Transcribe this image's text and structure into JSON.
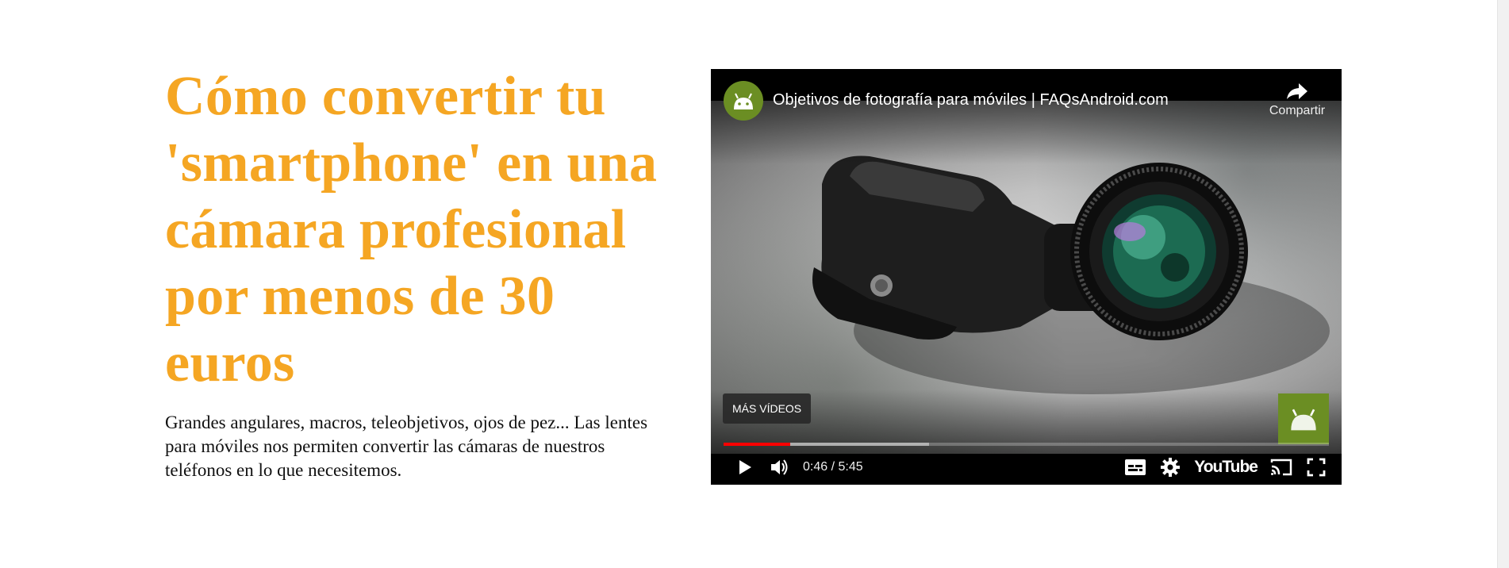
{
  "article": {
    "headline": "Cómo convertir tu 'smartphone' en una cámara profesional por menos de 30 euros",
    "summary": "Grandes angulares, macros, teleobjetivos, ojos de pez... Las lentes para móviles nos permiten convertir las cámaras de nuestros teléfonos en lo que necesitemos."
  },
  "player": {
    "title": "Objetivos de fotografía para móviles | FAQsAndroid.com",
    "share_label": "Compartir",
    "more_videos_label": "MÁS VÍDEOS",
    "time": "0:46 / 5:45",
    "brand_label": "YouTube",
    "progress_played": 0.11,
    "progress_buffered": 0.34,
    "icons": [
      "channel-avatar",
      "share-icon",
      "play-icon",
      "volume-icon",
      "subtitles-icon",
      "settings-icon",
      "cast-icon",
      "fullscreen-icon"
    ]
  },
  "colors": {
    "headline": "#f5a623",
    "progress_played": "#ff0000",
    "channel_green": "#6b8e23"
  }
}
